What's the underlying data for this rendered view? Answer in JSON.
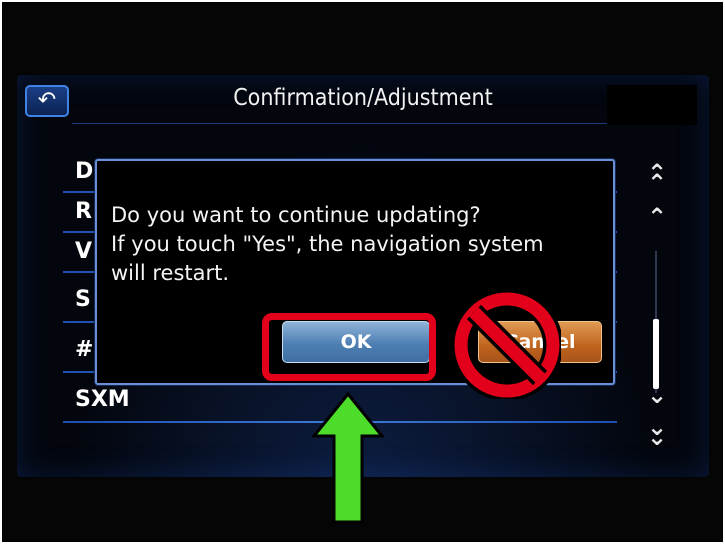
{
  "header": {
    "title": "Confirmation/Adjustment",
    "back_icon": "back-arrow-icon"
  },
  "list": {
    "items": [
      {
        "label": "D"
      },
      {
        "label": "R"
      },
      {
        "label": "V"
      },
      {
        "label": "S"
      },
      {
        "label": "#"
      },
      {
        "label": "SXM"
      }
    ]
  },
  "scroll": {
    "page_up_icon": "double-chevron-up-icon",
    "up_icon": "chevron-up-icon",
    "down_icon": "chevron-down-icon",
    "page_down_icon": "double-chevron-down-icon"
  },
  "dialog": {
    "message_lines": [
      "Do you want to continue updating?",
      "If you touch \"Yes\", the navigation system",
      "will restart."
    ],
    "ok_label": "OK",
    "cancel_label": "Cancel"
  },
  "annotations": {
    "highlight_color": "#e2001a",
    "arrow_color": "#4ddc2a"
  }
}
